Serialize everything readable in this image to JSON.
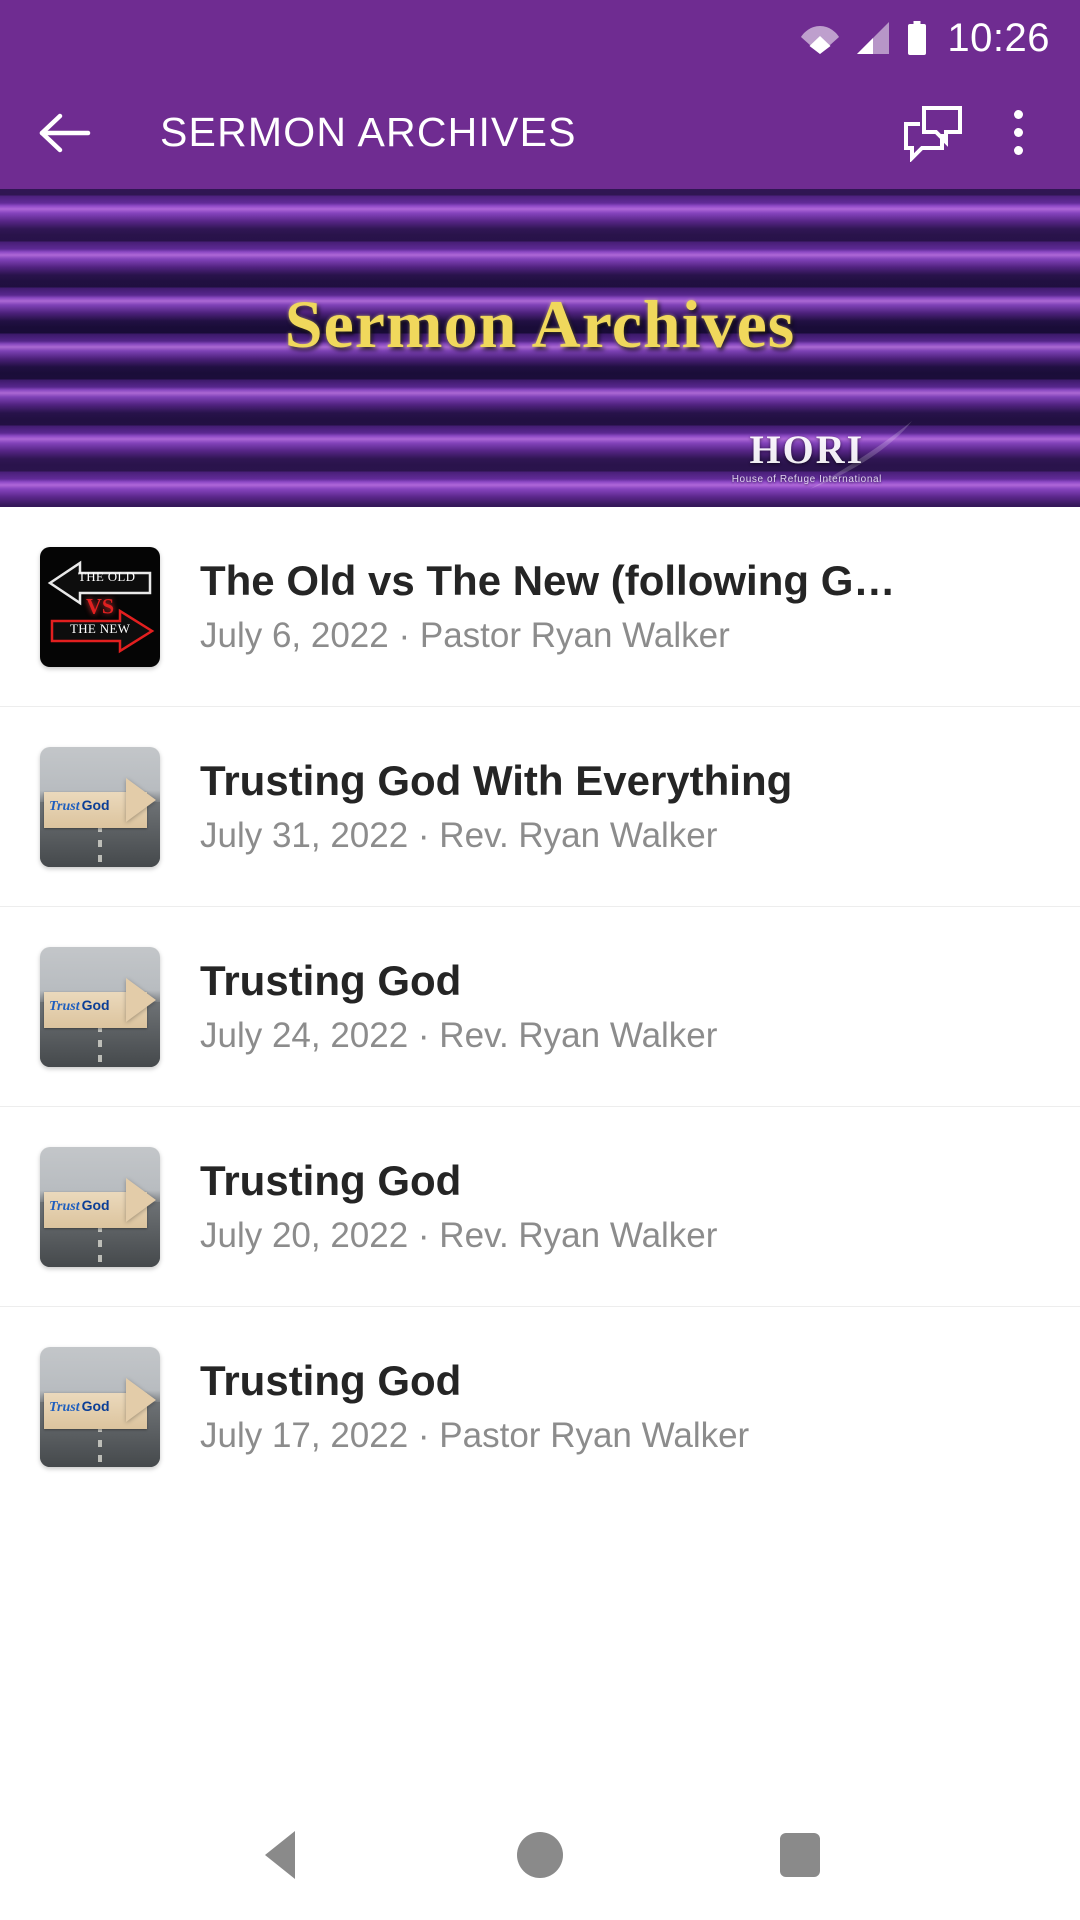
{
  "status_bar": {
    "time": "10:26",
    "icons": [
      "wifi-icon",
      "signal-icon",
      "battery-icon"
    ]
  },
  "app_bar": {
    "back_icon": "arrow-back-icon",
    "title": "SERMON ARCHIVES",
    "cast_icon": "multi-window-icon",
    "overflow_icon": "more-vert-icon"
  },
  "banner": {
    "title": "Sermon Archives",
    "watermark_main": "HORI",
    "watermark_sub": "House of Refuge International",
    "accent_gold": "#F0D85C",
    "bg_purple": "#5B2A94"
  },
  "theme": {
    "primary": "#6F2C91",
    "title_text": "#252525",
    "subtitle_text": "#8C8C8C",
    "divider": "#EDEDED"
  },
  "sermons": [
    {
      "title": "The Old vs The New (following G…",
      "subtitle": "July 6, 2022 · Pastor Ryan Walker",
      "date": "July 6, 2022",
      "speaker": "Pastor Ryan Walker",
      "thumb": "old-vs-new-thumbnail",
      "thumb_text": {
        "old": "THE OLD",
        "vs": "VS",
        "new": "THE NEW"
      }
    },
    {
      "title": "Trusting God With Everything",
      "subtitle": "July 31, 2022 · Rev. Ryan Walker",
      "date": "July 31, 2022",
      "speaker": "Rev. Ryan Walker",
      "thumb": "trust-god-thumbnail",
      "thumb_text": {
        "word1": "Trust",
        "word2": "God"
      }
    },
    {
      "title": "Trusting God",
      "subtitle": "July 24, 2022 · Rev. Ryan Walker",
      "date": "July 24, 2022",
      "speaker": "Rev. Ryan Walker",
      "thumb": "trust-god-thumbnail",
      "thumb_text": {
        "word1": "Trust",
        "word2": "God"
      }
    },
    {
      "title": "Trusting God",
      "subtitle": "July 20, 2022 · Rev. Ryan Walker",
      "date": "July 20, 2022",
      "speaker": "Rev. Ryan Walker",
      "thumb": "trust-god-thumbnail",
      "thumb_text": {
        "word1": "Trust",
        "word2": "God"
      }
    },
    {
      "title": "Trusting God",
      "subtitle": "July 17, 2022 · Pastor Ryan Walker",
      "date": "July 17, 2022",
      "speaker": "Pastor Ryan Walker",
      "thumb": "trust-god-thumbnail",
      "thumb_text": {
        "word1": "Trust",
        "word2": "God"
      }
    }
  ],
  "nav_bar": {
    "back_icon": "nav-back-triangle-icon",
    "home_icon": "nav-home-circle-icon",
    "recents_icon": "nav-recents-square-icon"
  }
}
